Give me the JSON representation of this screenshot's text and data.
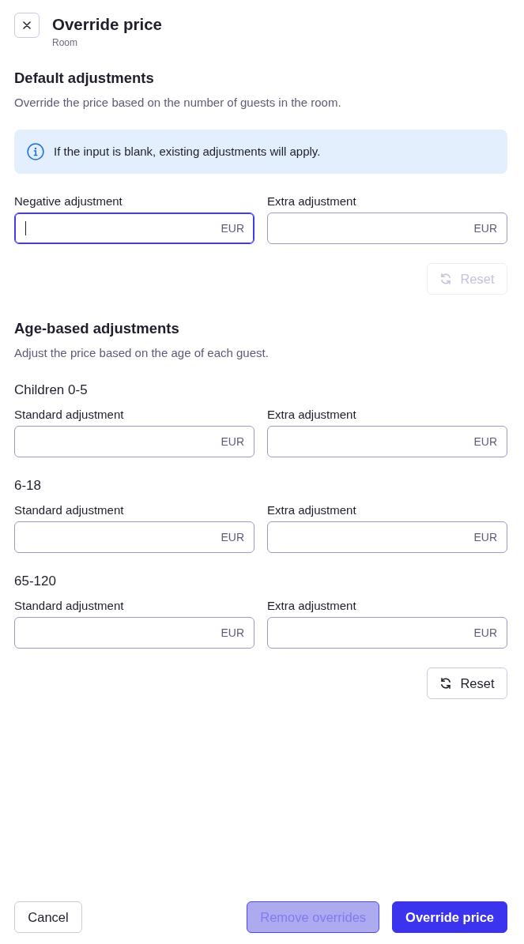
{
  "header": {
    "title": "Override price",
    "subtitle": "Room"
  },
  "default_adjustments": {
    "title": "Default adjustments",
    "description": "Override the price based on the number of guests in the room.",
    "notice": "If the input is blank, existing adjustments will apply.",
    "fields": [
      {
        "label": "Negative adjustment",
        "unit": "EUR",
        "focused": true
      },
      {
        "label": "Extra adjustment",
        "unit": "EUR",
        "focused": false
      }
    ],
    "reset_button": {
      "label": "Reset",
      "disabled": true
    }
  },
  "age_based_adjustments": {
    "title": "Age-based adjustments",
    "description": "Adjust the price based on the age of each guest.",
    "groups": [
      {
        "title": "Children 0-5",
        "fields": [
          {
            "label": "Standard adjustment",
            "unit": "EUR",
            "focused": false
          },
          {
            "label": "Extra adjustment",
            "unit": "EUR",
            "focused": false
          }
        ]
      },
      {
        "title": "6-18",
        "fields": [
          {
            "label": "Standard adjustment",
            "unit": "EUR",
            "focused": false
          },
          {
            "label": "Extra adjustment",
            "unit": "EUR",
            "focused": false
          }
        ]
      },
      {
        "title": "65-120",
        "fields": [
          {
            "label": "Standard adjustment",
            "unit": "EUR",
            "focused": false
          },
          {
            "label": "Extra adjustment",
            "unit": "EUR",
            "focused": false
          }
        ]
      }
    ],
    "reset_button": {
      "label": "Reset",
      "disabled": false
    }
  },
  "footer": {
    "start": [
      {
        "label": "Cancel",
        "kind": "secondary",
        "disabled": false
      }
    ],
    "end": [
      {
        "label": "Remove overrides",
        "kind": "primary",
        "disabled": true
      },
      {
        "label": "Override price",
        "kind": "primary",
        "disabled": false
      }
    ]
  }
}
